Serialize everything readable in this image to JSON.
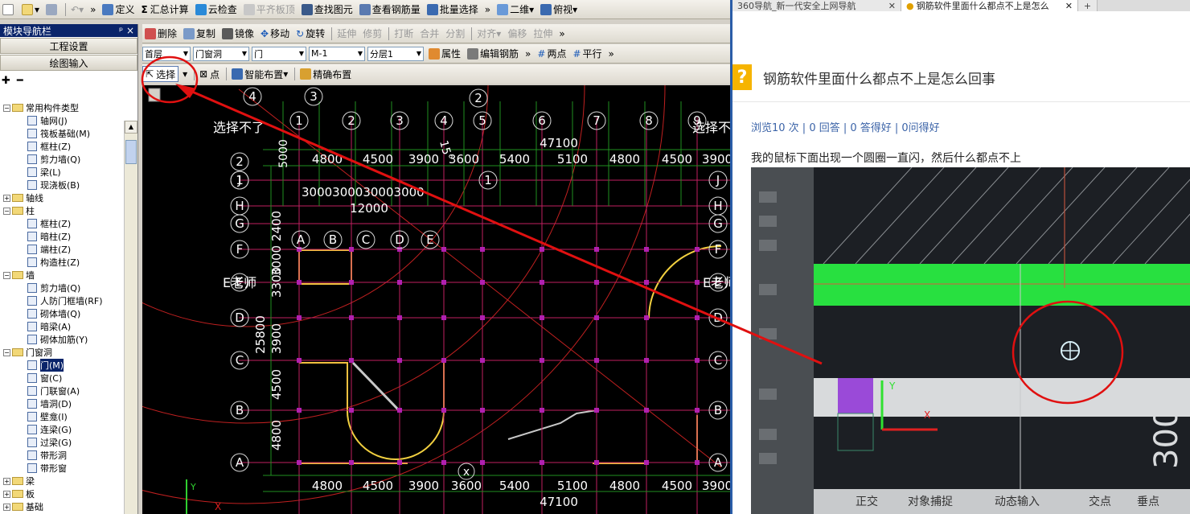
{
  "toolbar1": {
    "define": "定义",
    "sum": "汇总计算",
    "cloud_check": "云检查",
    "flat_top": "平齐板顶",
    "find": "查找图元",
    "view_rebar": "查看钢筋量",
    "batch_select": "批量选择",
    "view_2d": "二维",
    "view_top": "俯视",
    "more": "»"
  },
  "toolbar2": {
    "delete": "删除",
    "copy": "复制",
    "mirror": "镜像",
    "move": "移动",
    "rotate": "旋转",
    "extend": "延伸",
    "trim": "修剪",
    "break": "打断",
    "merge": "合并",
    "split": "分割",
    "align": "对齐",
    "offset": "偏移",
    "stretch": "拉伸",
    "more": "»"
  },
  "toolbar3": {
    "floor": "首层",
    "category": "门窗洞",
    "type": "门",
    "item": "M-1",
    "layer": "分层1",
    "props": "属性",
    "edit_rebar": "编辑钢筋",
    "two_points": "两点",
    "parallel": "平行",
    "more": "»"
  },
  "toolbar4": {
    "select": "选择",
    "point": "点",
    "smart_layout": "智能布置",
    "precise_layout": "精确布置"
  },
  "panel": {
    "title": "模块导航栏",
    "pin": "ᵖ ×",
    "project_settings": "工程设置",
    "drawing_input": "绘图输入",
    "tree": [
      {
        "label": "常用构件类型",
        "level": 0,
        "kind": "folder",
        "exp": "−"
      },
      {
        "label": "轴网(J)",
        "level": 1,
        "kind": "item"
      },
      {
        "label": "筏板基础(M)",
        "level": 1,
        "kind": "item"
      },
      {
        "label": "框柱(Z)",
        "level": 1,
        "kind": "item"
      },
      {
        "label": "剪力墙(Q)",
        "level": 1,
        "kind": "item"
      },
      {
        "label": "梁(L)",
        "level": 1,
        "kind": "item"
      },
      {
        "label": "现浇板(B)",
        "level": 1,
        "kind": "item"
      },
      {
        "label": "轴线",
        "level": 0,
        "kind": "folder",
        "exp": "+"
      },
      {
        "label": "柱",
        "level": 0,
        "kind": "folder",
        "exp": "−"
      },
      {
        "label": "框柱(Z)",
        "level": 1,
        "kind": "item"
      },
      {
        "label": "暗柱(Z)",
        "level": 1,
        "kind": "item"
      },
      {
        "label": "端柱(Z)",
        "level": 1,
        "kind": "item"
      },
      {
        "label": "构造柱(Z)",
        "level": 1,
        "kind": "item"
      },
      {
        "label": "墙",
        "level": 0,
        "kind": "folder",
        "exp": "−"
      },
      {
        "label": "剪力墙(Q)",
        "level": 1,
        "kind": "item"
      },
      {
        "label": "人防门框墙(RF)",
        "level": 1,
        "kind": "item"
      },
      {
        "label": "砌体墙(Q)",
        "level": 1,
        "kind": "item"
      },
      {
        "label": "暗梁(A)",
        "level": 1,
        "kind": "item"
      },
      {
        "label": "砌体加筋(Y)",
        "level": 1,
        "kind": "item"
      },
      {
        "label": "门窗洞",
        "level": 0,
        "kind": "folder",
        "exp": "−"
      },
      {
        "label": "门(M)",
        "level": 1,
        "kind": "item",
        "selected": true
      },
      {
        "label": "窗(C)",
        "level": 1,
        "kind": "item"
      },
      {
        "label": "门联窗(A)",
        "level": 1,
        "kind": "item"
      },
      {
        "label": "墙洞(D)",
        "level": 1,
        "kind": "item"
      },
      {
        "label": "壁龛(I)",
        "level": 1,
        "kind": "item"
      },
      {
        "label": "连梁(G)",
        "level": 1,
        "kind": "item"
      },
      {
        "label": "过梁(G)",
        "level": 1,
        "kind": "item"
      },
      {
        "label": "带形洞",
        "level": 1,
        "kind": "item"
      },
      {
        "label": "带形窗",
        "level": 1,
        "kind": "item"
      },
      {
        "label": "梁",
        "level": 0,
        "kind": "folder",
        "exp": "+"
      },
      {
        "label": "板",
        "level": 0,
        "kind": "folder",
        "exp": "+"
      },
      {
        "label": "基础",
        "level": 0,
        "kind": "folder",
        "exp": "+"
      },
      {
        "label": "其它",
        "level": 0,
        "kind": "folder",
        "exp": "+"
      }
    ]
  },
  "canvas": {
    "cannot_select": "选择不了",
    "watermark": "E老师",
    "top_axes": [
      "1",
      "2",
      "3",
      "4",
      "5",
      "6",
      "7",
      "8",
      "9"
    ],
    "top_dims": [
      "4800",
      "4500",
      "3900",
      "3600",
      "5400",
      "5100",
      "4800",
      "4500",
      "3900"
    ],
    "total_width": "47100",
    "row_axes": [
      "J",
      "H",
      "G",
      "F",
      "E",
      "D",
      "C",
      "B",
      "A"
    ],
    "left_total": "25800",
    "left_dims": [
      "3900",
      "4500",
      "4800"
    ],
    "inset_dims": "3000300030003000",
    "inset_total": "12000",
    "inset_axes": [
      "A",
      "B",
      "C",
      "D",
      "E"
    ],
    "arc_axes": [
      "4",
      "3",
      "2"
    ],
    "arc_dim_a": "15°",
    "arc_dim_b": "5000",
    "left_mid": [
      "3300",
      "3000",
      "2400"
    ],
    "x_marker": "x",
    "ucs_y": "Y",
    "ucs_x": "X"
  },
  "browser": {
    "tabs": [
      "360导航_新一代安全上网导航",
      "钢筋软件里面什么都点不上是怎么",
      "+"
    ],
    "question_icon": "?",
    "question_title": "钢筋软件里面什么都点不上是怎么回事",
    "stats": "浏览10 次 | 0 回答 | 0 答得好 | 0问得好",
    "body": "我的鼠标下面出现一个圆圈一直闪，然后什么都点不上",
    "photo_bar": [
      "正交",
      "对象捕捉",
      "动态输入",
      "交点",
      "垂点"
    ],
    "photo_dim": "300",
    "photo_ucs_x": "X",
    "photo_ucs_y": "Y"
  }
}
